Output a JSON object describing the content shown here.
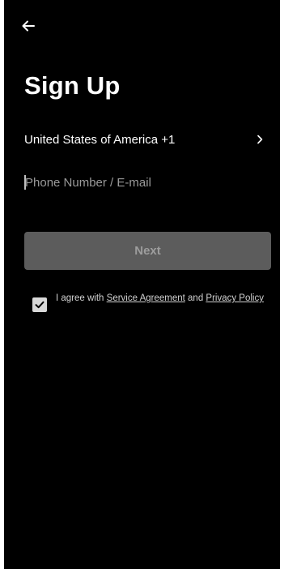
{
  "header": {
    "back_icon": "arrow-left-icon"
  },
  "title": "Sign Up",
  "country": {
    "label": "United States of America +1",
    "chevron_icon": "chevron-right-icon"
  },
  "contact_input": {
    "value": "",
    "placeholder": "Phone Number / E-mail"
  },
  "next_button": {
    "label": "Next",
    "enabled": false
  },
  "agreement": {
    "checked": true,
    "check_icon": "check-icon",
    "prefix": "I agree with ",
    "service_link": "Service Agreement",
    "and_text": " and ",
    "privacy_link": "Privacy Policy"
  },
  "colors": {
    "background": "#000000",
    "button_disabled_bg": "#5c5c5c",
    "button_disabled_text": "#9d9d9d",
    "text_primary": "#ffffff",
    "text_secondary": "#d0d0d0"
  }
}
